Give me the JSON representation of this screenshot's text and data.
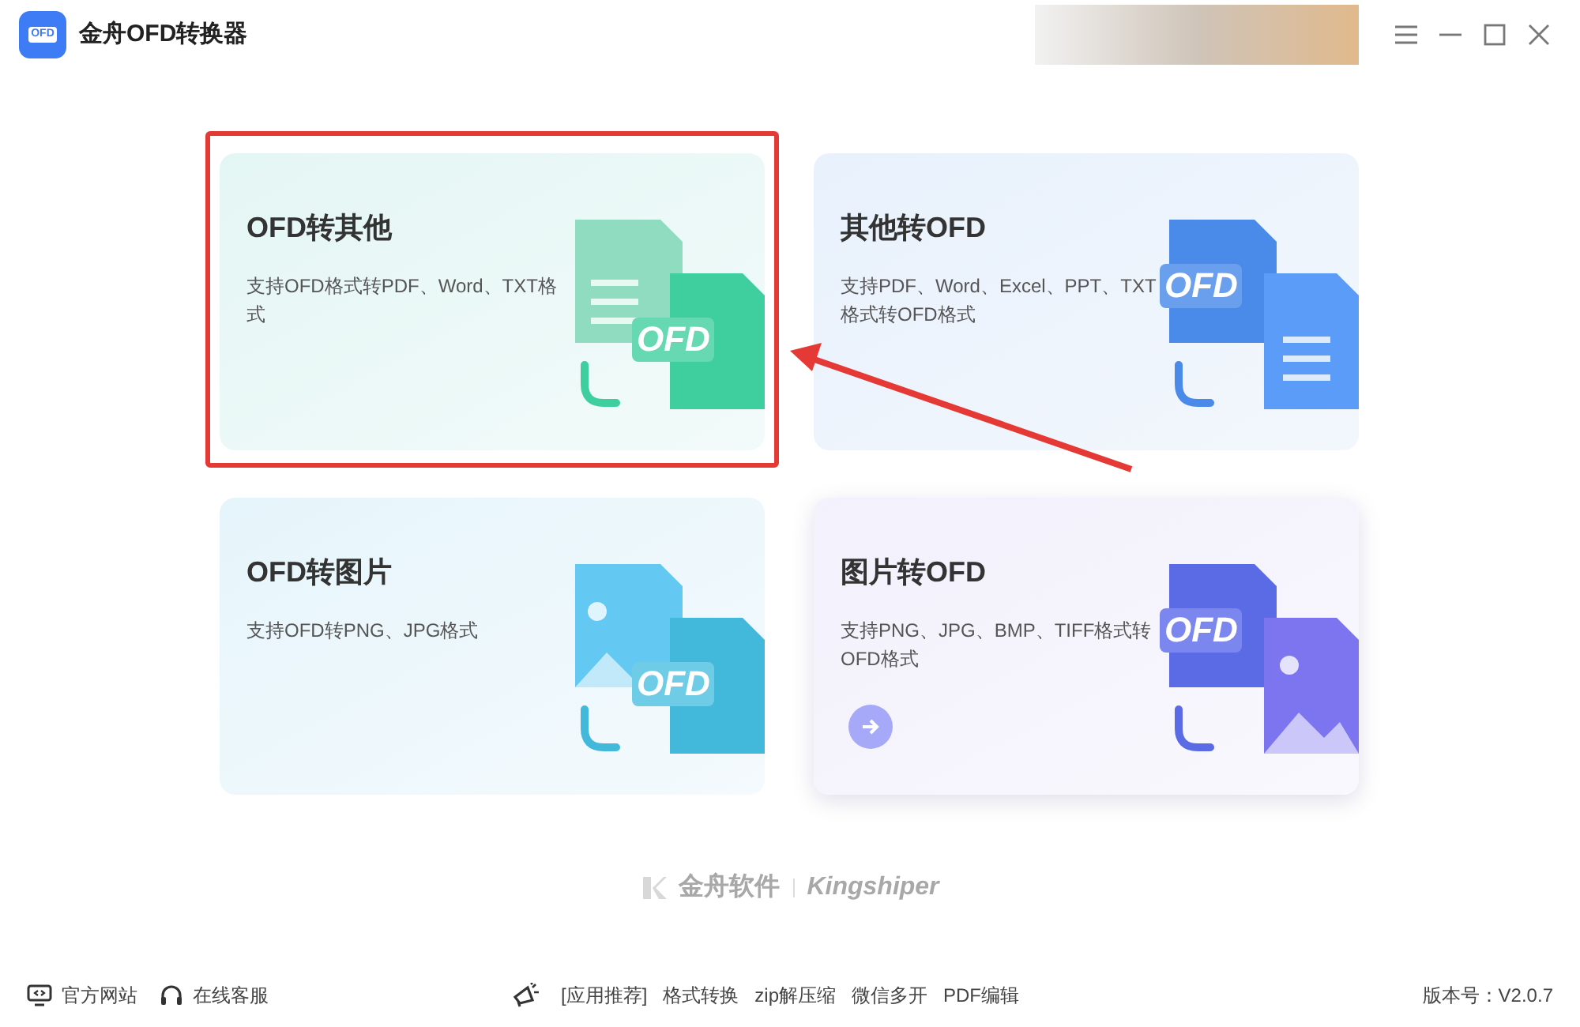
{
  "window": {
    "title": "金舟OFD转换器",
    "logo_label": "OFD"
  },
  "cards": [
    {
      "kind": "ofd-to-doc",
      "title": "OFD转其他",
      "description": "支持OFD格式转PDF、Word、TXT格式",
      "icon_label": "OFD",
      "highlighted": true,
      "hovered": false
    },
    {
      "kind": "doc-to-ofd",
      "title": "其他转OFD",
      "description": "支持PDF、Word、Excel、PPT、TXT格式转OFD格式",
      "icon_label": "OFD",
      "highlighted": false,
      "hovered": false
    },
    {
      "kind": "ofd-to-image",
      "title": "OFD转图片",
      "description": "支持OFD转PNG、JPG格式",
      "icon_label": "OFD",
      "highlighted": false,
      "hovered": false
    },
    {
      "kind": "image-to-ofd",
      "title": "图片转OFD",
      "description": "支持PNG、JPG、BMP、TIFF格式转OFD格式",
      "icon_label": "OFD",
      "highlighted": false,
      "hovered": true
    }
  ],
  "brand": {
    "name": "金舟软件",
    "name_en": "Kingshiper"
  },
  "footer": {
    "links": [
      {
        "kind": "website",
        "label": "官方网站"
      },
      {
        "kind": "support",
        "label": "在线客服"
      }
    ],
    "recommend_label": "[应用推荐]",
    "apps": [
      "格式转换",
      "zip解压缩",
      "微信多开",
      "PDF编辑"
    ],
    "version": "版本号：V2.0.7"
  }
}
